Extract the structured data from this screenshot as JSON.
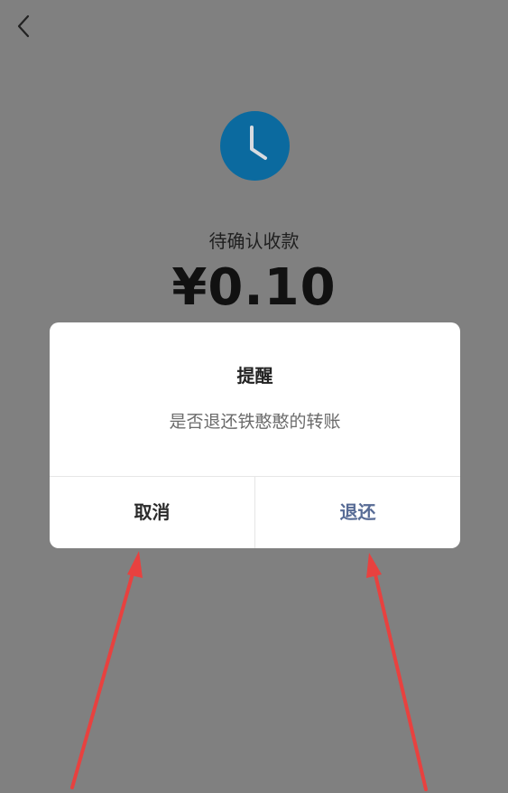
{
  "header": {
    "back_icon": "chevron-left-icon"
  },
  "transfer": {
    "status_icon": "clock-icon",
    "status_label": "待确认收款",
    "amount": "¥0.10"
  },
  "dialog": {
    "title": "提醒",
    "message": "是否退还铁憨憨的转账",
    "cancel_label": "取消",
    "confirm_label": "退还"
  },
  "colors": {
    "overlay": "#808080",
    "clock": "#0b6a9f",
    "confirm": "#576b95",
    "arrow": "#e8413f"
  }
}
